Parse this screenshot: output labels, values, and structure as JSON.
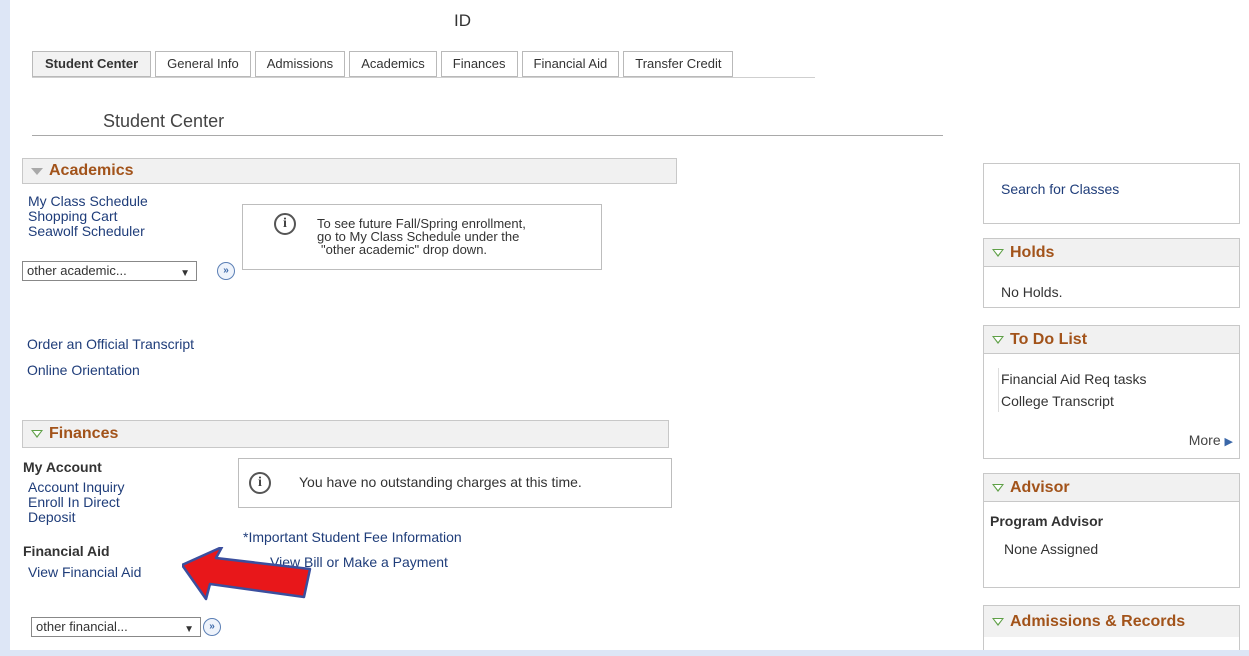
{
  "header": {
    "id_label": "ID"
  },
  "tabs": [
    {
      "label": "Student Center",
      "active": true
    },
    {
      "label": "General Info"
    },
    {
      "label": "Admissions"
    },
    {
      "label": "Academics"
    },
    {
      "label": "Finances"
    },
    {
      "label": "Financial Aid"
    },
    {
      "label": "Transfer Credit"
    }
  ],
  "page_title": "Student Center",
  "academics": {
    "title": "Academics",
    "links": [
      "My Class Schedule",
      "Shopping Cart",
      "Seawolf Scheduler"
    ],
    "select_value": "other academic...",
    "message_line1": "To see future Fall/Spring enrollment,",
    "message_line2": "go to My Class Schedule under the",
    "message_line3": "\"other academic\" drop down.",
    "extra_links": [
      "Order an Official Transcript",
      "Online Orientation"
    ]
  },
  "finances": {
    "title": "Finances",
    "my_account_label": "My Account",
    "account_links": [
      "Account Inquiry",
      "Enroll In Direct",
      "Deposit"
    ],
    "financial_aid_label": "Financial Aid",
    "aid_link": "View Financial Aid",
    "message": "You have no outstanding charges at this time.",
    "fee_link": "*Important Student Fee Information",
    "bill_link": "View Bill or Make a Payment",
    "select_value": "other financial..."
  },
  "right": {
    "search_link": "Search for Classes",
    "holds": {
      "title": "Holds",
      "text": "No Holds."
    },
    "todo": {
      "title": "To Do List",
      "items": [
        "Financial Aid Req tasks",
        "College Transcript"
      ],
      "more": "More"
    },
    "advisor": {
      "title": "Advisor",
      "label": "Program Advisor",
      "value": "None Assigned"
    },
    "admissions": {
      "title": "Admissions & Records"
    }
  },
  "colors": {
    "section_title": "#a2531a",
    "link": "#1f3d7a",
    "arrow_fill": "#e8171a",
    "arrow_stroke": "#3b4f9e"
  }
}
